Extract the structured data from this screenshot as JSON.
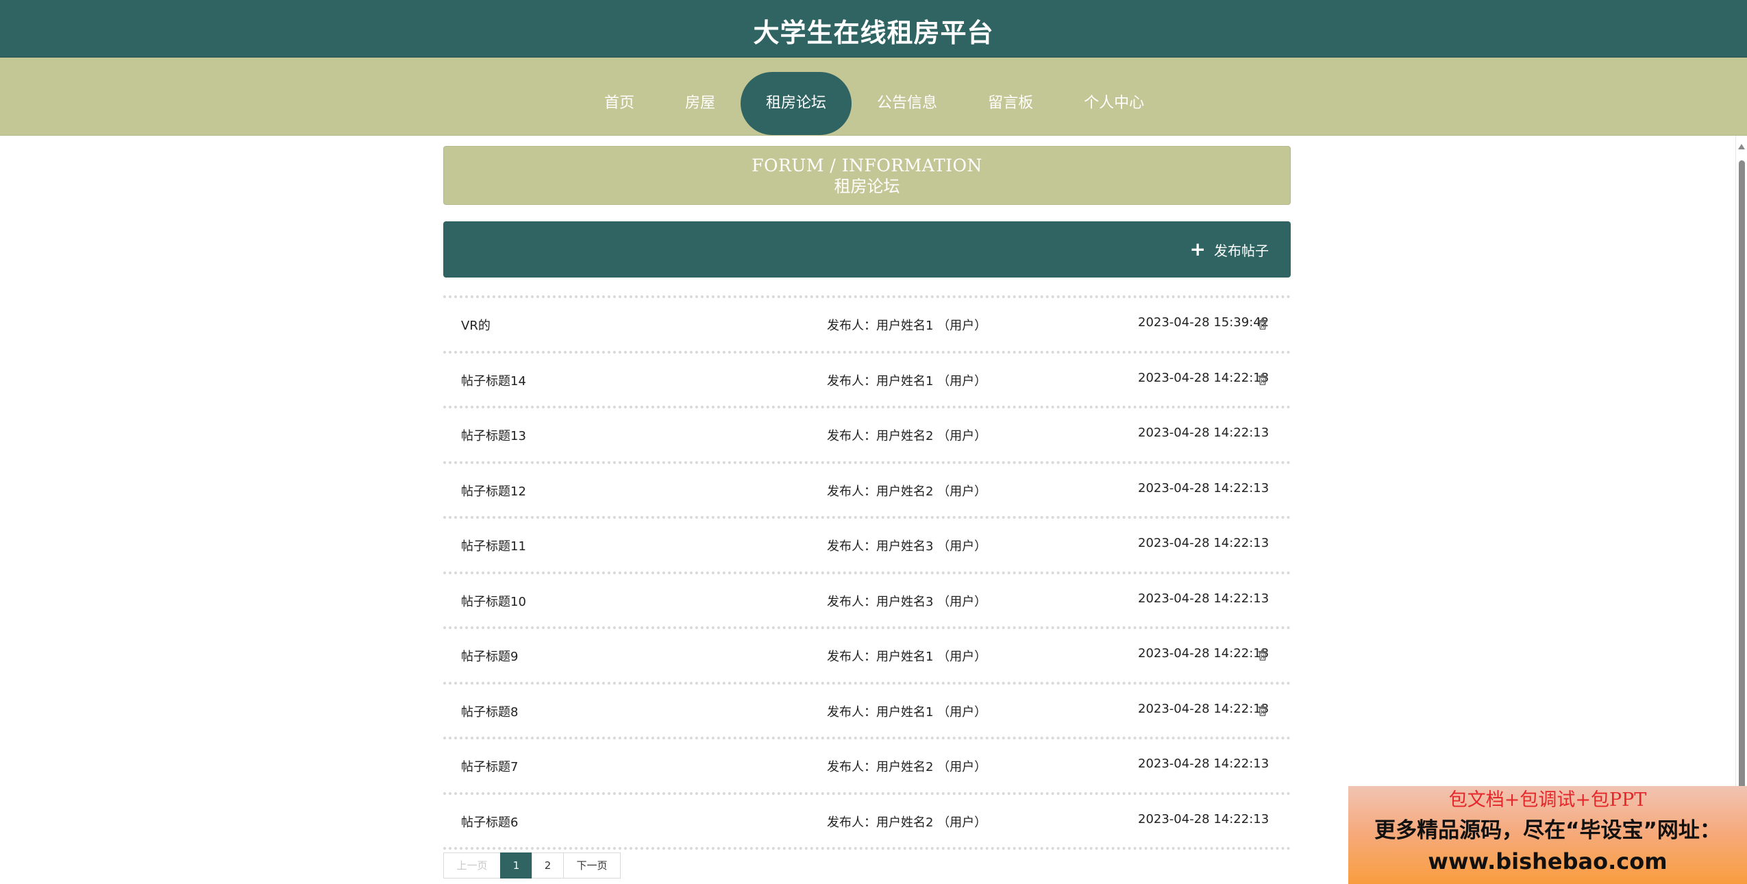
{
  "header": {
    "site_title": "大学生在线租房平台"
  },
  "nav": {
    "items": [
      {
        "label": "首页"
      },
      {
        "label": "房屋"
      },
      {
        "label": "租房论坛"
      },
      {
        "label": "公告信息"
      },
      {
        "label": "留言板"
      },
      {
        "label": "个人中心"
      }
    ],
    "active_index": 2
  },
  "page_header": {
    "title_en": "FORUM / INFORMATION",
    "title_cn": "租房论坛"
  },
  "toolbar": {
    "publish_icon": "+",
    "publish_label": "发布帖子"
  },
  "posts": [
    {
      "title": "VR的",
      "author": "发布人：用户姓名1 （用户）",
      "time": "2023-04-28 15:39:42",
      "deletable": true
    },
    {
      "title": "帖子标题14",
      "author": "发布人：用户姓名1 （用户）",
      "time": "2023-04-28 14:22:13",
      "deletable": true
    },
    {
      "title": "帖子标题13",
      "author": "发布人：用户姓名2 （用户）",
      "time": "2023-04-28 14:22:13",
      "deletable": false
    },
    {
      "title": "帖子标题12",
      "author": "发布人：用户姓名2 （用户）",
      "time": "2023-04-28 14:22:13",
      "deletable": false
    },
    {
      "title": "帖子标题11",
      "author": "发布人：用户姓名3 （用户）",
      "time": "2023-04-28 14:22:13",
      "deletable": false
    },
    {
      "title": "帖子标题10",
      "author": "发布人：用户姓名3 （用户）",
      "time": "2023-04-28 14:22:13",
      "deletable": false
    },
    {
      "title": "帖子标题9",
      "author": "发布人：用户姓名1 （用户）",
      "time": "2023-04-28 14:22:13",
      "deletable": true
    },
    {
      "title": "帖子标题8",
      "author": "发布人：用户姓名1 （用户）",
      "time": "2023-04-28 14:22:13",
      "deletable": true
    },
    {
      "title": "帖子标题7",
      "author": "发布人：用户姓名2 （用户）",
      "time": "2023-04-28 14:22:13",
      "deletable": false
    },
    {
      "title": "帖子标题6",
      "author": "发布人：用户姓名2 （用户）",
      "time": "2023-04-28 14:22:13",
      "deletable": false
    }
  ],
  "pagination": {
    "prev_label": "上一页",
    "pages": [
      "1",
      "2"
    ],
    "current": "1",
    "next_label": "下一页"
  },
  "promo": {
    "line1": "包文档+包调试+包PPT",
    "line2": "更多精品源码，尽在“毕设宝”网址：",
    "line3": "www.bishebao.com"
  },
  "icons": {
    "delete": "trash-icon",
    "publish": "plus-icon"
  },
  "colors": {
    "primary": "#2f6463",
    "accent": "#c3c795",
    "promo_text_red": "#e5272c"
  }
}
